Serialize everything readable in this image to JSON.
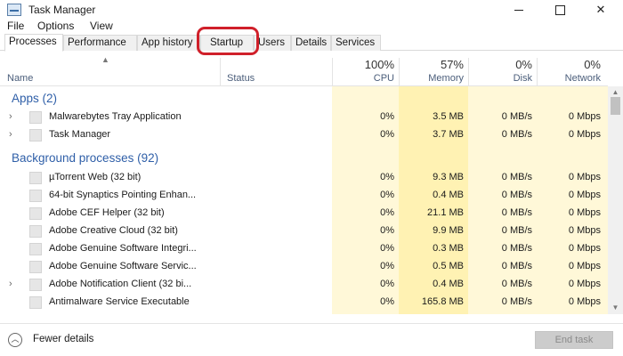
{
  "window": {
    "title": "Task Manager",
    "icon": "task-manager-icon",
    "controls": [
      "minimize-icon",
      "maximize-icon",
      "close-icon"
    ]
  },
  "menu": [
    "File",
    "Options",
    "View"
  ],
  "tabs": [
    {
      "label": "Processes",
      "active": true
    },
    {
      "label": "Performance",
      "active": false
    },
    {
      "label": "App history",
      "active": false
    },
    {
      "label": "Startup",
      "active": false,
      "highlighted": true
    },
    {
      "label": "Users",
      "active": false
    },
    {
      "label": "Details",
      "active": false
    },
    {
      "label": "Services",
      "active": false
    }
  ],
  "columns": {
    "name": "Name",
    "status": "Status",
    "cpu": {
      "pct": "100%",
      "label": "CPU"
    },
    "memory": {
      "pct": "57%",
      "label": "Memory"
    },
    "disk": {
      "pct": "0%",
      "label": "Disk"
    },
    "network": {
      "pct": "0%",
      "label": "Network"
    }
  },
  "groups": {
    "apps": "Apps (2)",
    "background": "Background processes (92)"
  },
  "apps": [
    {
      "name": "Malwarebytes Tray Application",
      "cpu": "0%",
      "memory": "3.5 MB",
      "disk": "0 MB/s",
      "network": "0 Mbps"
    },
    {
      "name": "Task Manager",
      "cpu": "0%",
      "memory": "3.7 MB",
      "disk": "0 MB/s",
      "network": "0 Mbps"
    }
  ],
  "background": [
    {
      "name": "µTorrent Web (32 bit)",
      "cpu": "0%",
      "memory": "9.3 MB",
      "disk": "0 MB/s",
      "network": "0 Mbps"
    },
    {
      "name": "64-bit Synaptics Pointing Enhan...",
      "cpu": "0%",
      "memory": "0.4 MB",
      "disk": "0 MB/s",
      "network": "0 Mbps"
    },
    {
      "name": "Adobe CEF Helper (32 bit)",
      "cpu": "0%",
      "memory": "21.1 MB",
      "disk": "0 MB/s",
      "network": "0 Mbps"
    },
    {
      "name": "Adobe Creative Cloud (32 bit)",
      "cpu": "0%",
      "memory": "9.9 MB",
      "disk": "0 MB/s",
      "network": "0 Mbps"
    },
    {
      "name": "Adobe Genuine Software Integri...",
      "cpu": "0%",
      "memory": "0.3 MB",
      "disk": "0 MB/s",
      "network": "0 Mbps"
    },
    {
      "name": "Adobe Genuine Software Servic...",
      "cpu": "0%",
      "memory": "0.5 MB",
      "disk": "0 MB/s",
      "network": "0 Mbps"
    },
    {
      "name": "Adobe Notification Client (32 bi...",
      "cpu": "0%",
      "memory": "0.4 MB",
      "disk": "0 MB/s",
      "network": "0 Mbps"
    },
    {
      "name": "Antimalware Service Executable",
      "cpu": "0%",
      "memory": "165.8 MB",
      "disk": "0 MB/s",
      "network": "0 Mbps"
    }
  ],
  "footer": {
    "fewer_details": "Fewer details",
    "end_task": "End task"
  },
  "colors": {
    "highlight": "#d0202a",
    "group_heading": "#2f5fa8",
    "memory_column": "#fff2b3",
    "metric_column": "#fff8d8"
  }
}
